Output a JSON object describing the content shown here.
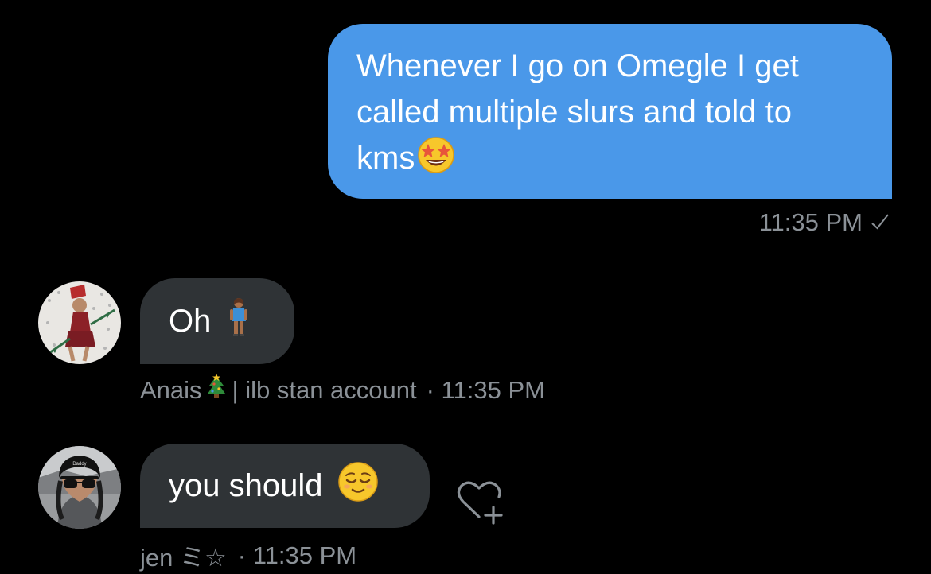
{
  "sent_message": {
    "lines": [
      "Whenever I go on Omegle I get",
      "called multiple slurs and told to",
      "kms"
    ],
    "emoji": "star-struck-emoji",
    "time": "11:35 PM",
    "status_icon": "check-icon"
  },
  "messages": [
    {
      "text": "Oh",
      "emoji": "woman-standing-emoji",
      "sender": "Anais",
      "sender_emoji": "christmas-tree-emoji",
      "sender_suffix": "| ilb stan account",
      "time": "· 11:35 PM"
    },
    {
      "text": "you should",
      "emoji": "relieved-face-emoji",
      "sender": "jen ミ☆",
      "time": "· 11:35 PM"
    }
  ],
  "colors": {
    "background": "#000000",
    "sent_bubble": "#4a98e9",
    "received_bubble": "#2f3336",
    "meta_text": "#8b9197"
  }
}
